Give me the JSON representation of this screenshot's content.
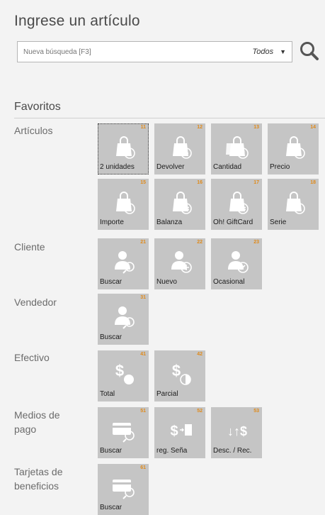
{
  "header": {
    "title": "Ingrese un artículo",
    "search_placeholder": "Nueva búsqueda [F3]",
    "scope_value": "Todos"
  },
  "favorites": {
    "title": "Favoritos",
    "categories": [
      {
        "label": "Artículos",
        "tiles": [
          {
            "num": "11",
            "label": "2 unidades",
            "icon": "bag-number-icon",
            "badge": "2"
          },
          {
            "num": "12",
            "label": "Devolver",
            "icon": "bag-return-icon"
          },
          {
            "num": "13",
            "label": "Cantidad",
            "icon": "bags-quantity-icon",
            "badge": "N"
          },
          {
            "num": "14",
            "label": "Precio",
            "icon": "bag-question-icon",
            "badge": "?"
          },
          {
            "num": "15",
            "label": "Importe",
            "icon": "bag-money-icon",
            "badge": "$"
          },
          {
            "num": "16",
            "label": "Balanza",
            "icon": "bag-scale-icon"
          },
          {
            "num": "17",
            "label": "Oh! GiftCard",
            "icon": "bag-giftcard-icon"
          },
          {
            "num": "18",
            "label": "Serie",
            "icon": "bag-serial-icon",
            "badge": "#"
          }
        ]
      },
      {
        "label": "Cliente",
        "tiles": [
          {
            "num": "21",
            "label": "Buscar",
            "icon": "customer-search-icon"
          },
          {
            "num": "22",
            "label": "Nuevo",
            "icon": "customer-add-icon"
          },
          {
            "num": "23",
            "label": "Ocasional",
            "icon": "customer-occasional-icon"
          }
        ]
      },
      {
        "label": "Vendedor",
        "tiles": [
          {
            "num": "31",
            "label": "Buscar",
            "icon": "seller-search-icon"
          }
        ]
      },
      {
        "label": "Efectivo",
        "tiles": [
          {
            "num": "41",
            "label": "Total",
            "icon": "cash-total-icon",
            "badge": "$"
          },
          {
            "num": "42",
            "label": "Parcial",
            "icon": "cash-partial-icon",
            "badge": "$"
          }
        ]
      },
      {
        "label": "Medios de pago",
        "tiles": [
          {
            "num": "51",
            "label": "Buscar",
            "icon": "card-search-icon"
          },
          {
            "num": "52",
            "label": "reg. Seña",
            "icon": "deposit-register-icon",
            "badge": "$"
          },
          {
            "num": "53",
            "label": "Desc. / Rec.",
            "icon": "discount-surcharge-icon",
            "badge": "↓↑$"
          }
        ]
      },
      {
        "label": "Tarjetas de beneficios",
        "tiles": [
          {
            "num": "61",
            "label": "Buscar",
            "icon": "benefit-card-search-icon"
          }
        ]
      }
    ]
  },
  "colors": {
    "tile_bg": "#c5c5c5",
    "number_accent": "#e08a1a",
    "page_bg": "#f3f3f3"
  }
}
